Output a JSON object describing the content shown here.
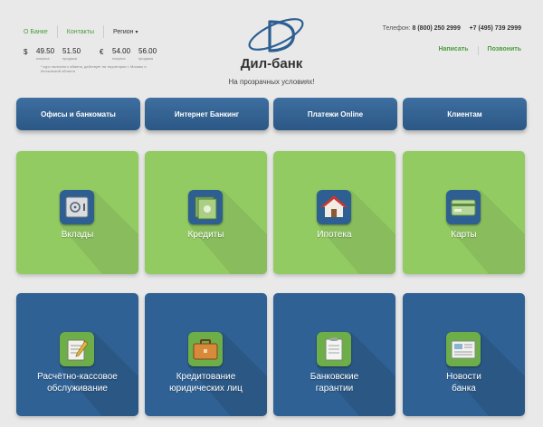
{
  "header": {
    "links": [
      "О Банке",
      "Контакты"
    ],
    "region_label": "Регион",
    "bank_name": "Дил-банк",
    "slogan": "На прозрачных условиях!",
    "phone_label": "Телефон:",
    "phone_1": "8 (800) 250 2999",
    "phone_2": "+7 (495) 739 2999",
    "write_label": "Написать",
    "call_label": "Позвонить"
  },
  "rates": {
    "usd_symbol": "$",
    "usd_buy": "49.50",
    "usd_sell": "51.50",
    "eur_symbol": "€",
    "eur_buy": "54.00",
    "eur_sell": "56.00",
    "buy_label": "покупка",
    "sell_label": "продажа",
    "note": "* курс наличного обмена, действует на территории г. Москвы и Московской области"
  },
  "nav": {
    "items": [
      "Офисы и банкоматы",
      "Интернет Банкинг",
      "Платежи Online",
      "Клиентам"
    ]
  },
  "tiles": {
    "row1": [
      {
        "label": "Вклады",
        "icon": "safe-icon"
      },
      {
        "label": "Кредиты",
        "icon": "money-icon"
      },
      {
        "label": "Ипотека",
        "icon": "house-icon"
      },
      {
        "label": "Карты",
        "icon": "card-icon"
      }
    ],
    "row2": [
      {
        "label1": "Расчётно-кассовое",
        "label2": "обслуживание",
        "icon": "notepad-icon"
      },
      {
        "label1": "Кредитование",
        "label2": "юридических лиц",
        "icon": "briefcase-icon"
      },
      {
        "label1": "Банковские",
        "label2": "гарантии",
        "icon": "document-icon"
      },
      {
        "label1": "Новости",
        "label2": "банка",
        "icon": "newspaper-icon"
      }
    ]
  },
  "colors": {
    "green_tile": "#93cb63",
    "blue_tile": "#2f6194",
    "link_green": "#4a9c3a",
    "nav_blue": "#2b5785"
  }
}
